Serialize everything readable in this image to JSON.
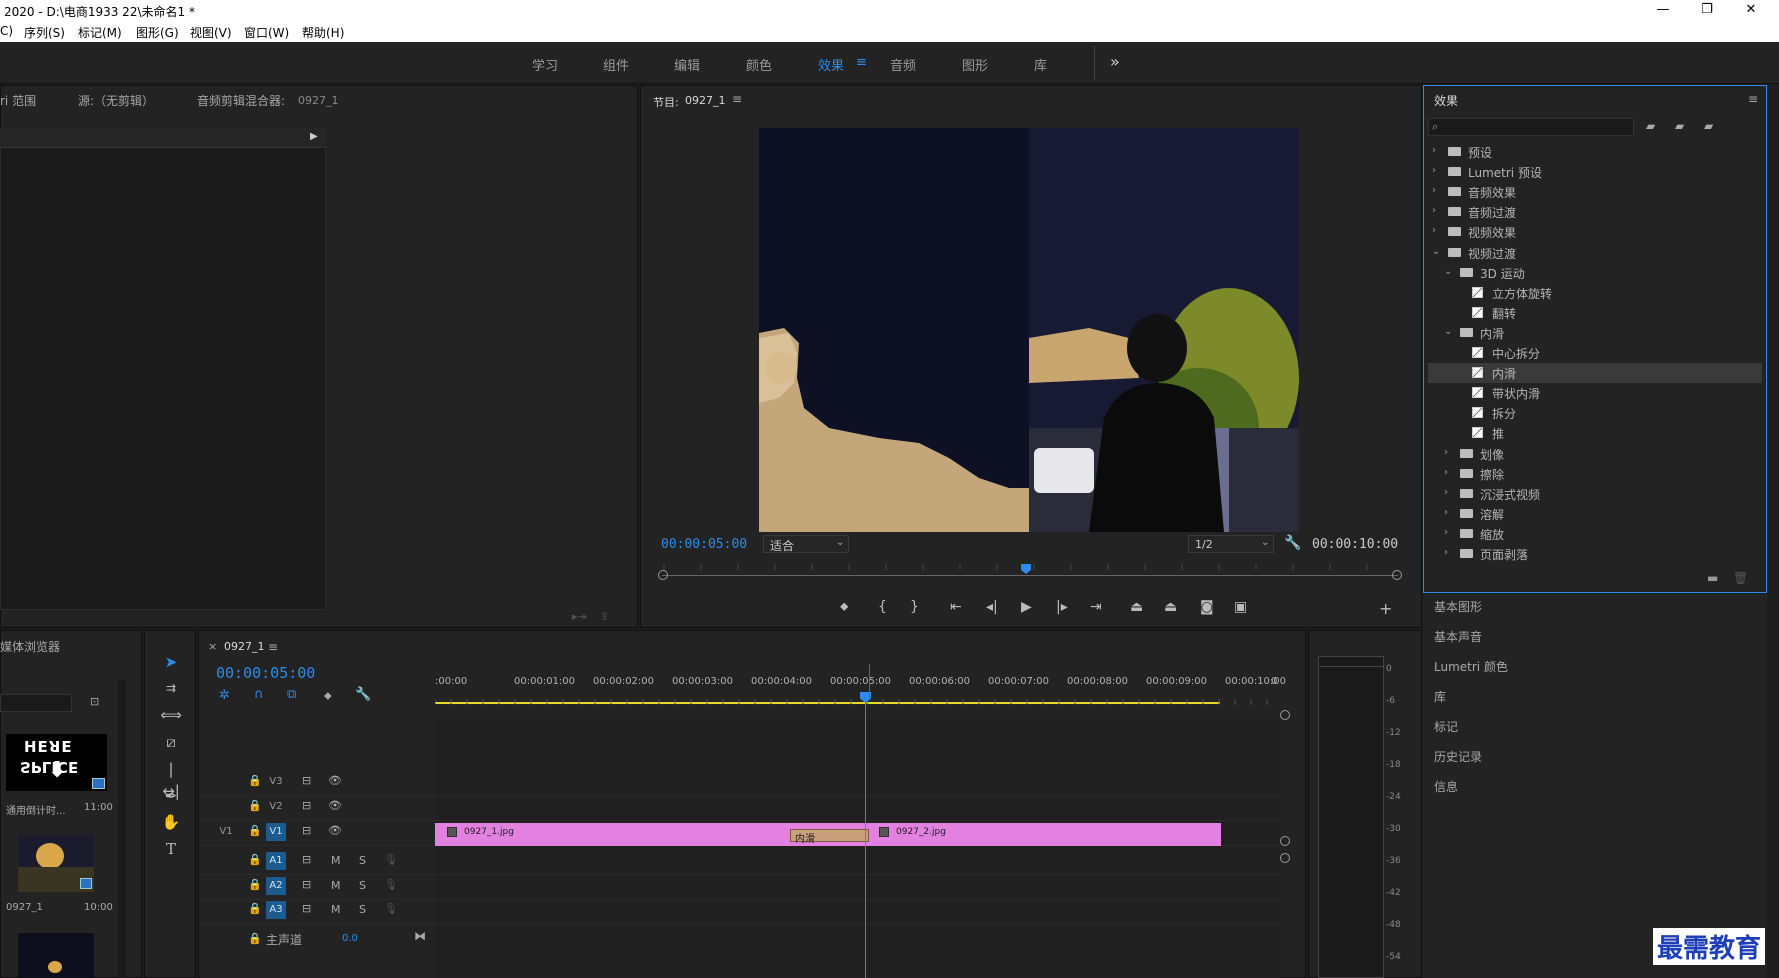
{
  "window": {
    "title": "2020 - D:\\电商1933 22\\未命名1 *",
    "min": "—",
    "max": "❐",
    "close": "✕"
  },
  "menu": [
    "C)",
    "序列(S)",
    "标记(M)",
    "图形(G)",
    "视图(V)",
    "窗口(W)",
    "帮助(H)"
  ],
  "workspaces": [
    "学习",
    "组件",
    "编辑",
    "颜色",
    "效果",
    "音频",
    "图形",
    "库"
  ],
  "active_workspace": "效果",
  "ws_more": "»",
  "source_panel": {
    "tabs": [
      "ri 范围",
      "源:（无剪辑）",
      "音频剪辑混合器:"
    ],
    "mixer_seq": "0927_1"
  },
  "program": {
    "tab": "节目:",
    "seq": "0927_1",
    "timecode_left": "00:00:05:00",
    "fit": "适合",
    "resolution": "1/2",
    "timecode_right": "00:00:10:00"
  },
  "effects": {
    "title": "效果",
    "search_placeholder": "",
    "tree": [
      {
        "label": "预设",
        "type": "folder-special",
        "level": 0,
        "open": false
      },
      {
        "label": "Lumetri 预设",
        "type": "folder-special",
        "level": 0,
        "open": false
      },
      {
        "label": "音频效果",
        "type": "folder",
        "level": 0,
        "open": false
      },
      {
        "label": "音频过渡",
        "type": "folder",
        "level": 0,
        "open": false
      },
      {
        "label": "视频效果",
        "type": "folder",
        "level": 0,
        "open": false
      },
      {
        "label": "视频过渡",
        "type": "folder",
        "level": 0,
        "open": true
      },
      {
        "label": "3D 运动",
        "type": "folder",
        "level": 1,
        "open": true
      },
      {
        "label": "立方体旋转",
        "type": "effect",
        "level": 2
      },
      {
        "label": "翻转",
        "type": "effect",
        "level": 2
      },
      {
        "label": "内滑",
        "type": "folder",
        "level": 1,
        "open": true
      },
      {
        "label": "中心拆分",
        "type": "effect",
        "level": 2
      },
      {
        "label": "内滑",
        "type": "effect",
        "level": 2,
        "selected": true
      },
      {
        "label": "带状内滑",
        "type": "effect",
        "level": 2
      },
      {
        "label": "拆分",
        "type": "effect",
        "level": 2
      },
      {
        "label": "推",
        "type": "effect",
        "level": 2
      },
      {
        "label": "划像",
        "type": "folder",
        "level": 1,
        "open": false
      },
      {
        "label": "擦除",
        "type": "folder",
        "level": 1,
        "open": false
      },
      {
        "label": "沉浸式视频",
        "type": "folder",
        "level": 1,
        "open": false
      },
      {
        "label": "溶解",
        "type": "folder",
        "level": 1,
        "open": false
      },
      {
        "label": "缩放",
        "type": "folder",
        "level": 1,
        "open": false
      },
      {
        "label": "页面剥落",
        "type": "folder",
        "level": 1,
        "open": false
      }
    ]
  },
  "side_panels": [
    "基本图形",
    "基本声音",
    "Lumetri 颜色",
    "库",
    "标记",
    "历史记录",
    "信息"
  ],
  "project": {
    "title": "媒体浏览器",
    "items": [
      {
        "name": "通用倒计时...",
        "duration": "11:00",
        "thumb_text_top": "HEꓤE",
        "thumb_text_bottom": "SPLICE"
      },
      {
        "name": "0927_1",
        "duration": "10:00"
      }
    ]
  },
  "timeline": {
    "tab_close": "×",
    "seq": "0927_1",
    "timecode": "00:00:05:00",
    "ruler": [
      ":00:00",
      "00:00:01:00",
      "00:00:02:00",
      "00:00:03:00",
      "00:00:04:00",
      "00:00:05:00",
      "00:00:06:00",
      "00:00:07:00",
      "00:00:08:00",
      "00:00:09:00",
      "00:00:10:00",
      "0"
    ],
    "video_tracks": [
      "V3",
      "V2",
      "V1"
    ],
    "audio_tracks": [
      "A1",
      "A2",
      "A3"
    ],
    "src_patch": "V1",
    "master": "主声道",
    "master_val": "0.0",
    "mute": "M",
    "solo": "S",
    "clips": [
      {
        "name": "0927_1.jpg"
      },
      {
        "name": "0927_2.jpg"
      }
    ],
    "transition": "内滑",
    "playhead_fraction": 0.5
  },
  "meter": [
    "0",
    "-6",
    "-12",
    "-18",
    "-24",
    "-30",
    "-36",
    "-42",
    "-48",
    "-54"
  ],
  "watermark": "最需教育",
  "colors": {
    "accent": "#2d8ceb",
    "clip": "#e281e0",
    "transition": "#c9a07b",
    "work_area": "#e8d92a"
  }
}
